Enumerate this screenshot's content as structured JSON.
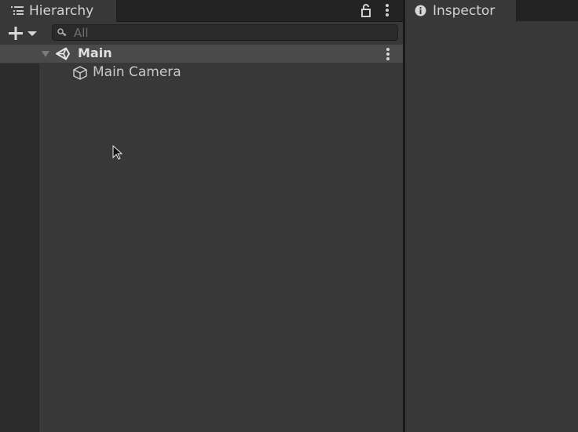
{
  "hierarchy": {
    "tab_label": "Hierarchy",
    "search": {
      "value": "",
      "placeholder": "All"
    },
    "scene": {
      "name": "Main"
    },
    "objects": [
      {
        "name": "Main Camera",
        "icon": "cube-icon"
      }
    ]
  },
  "inspector": {
    "tab_label": "Inspector"
  },
  "colors": {
    "panel_bg": "#383838",
    "tab_bg": "#232323",
    "scene_row_bg": "#4a4a4a",
    "text": "#c4c4c4"
  }
}
